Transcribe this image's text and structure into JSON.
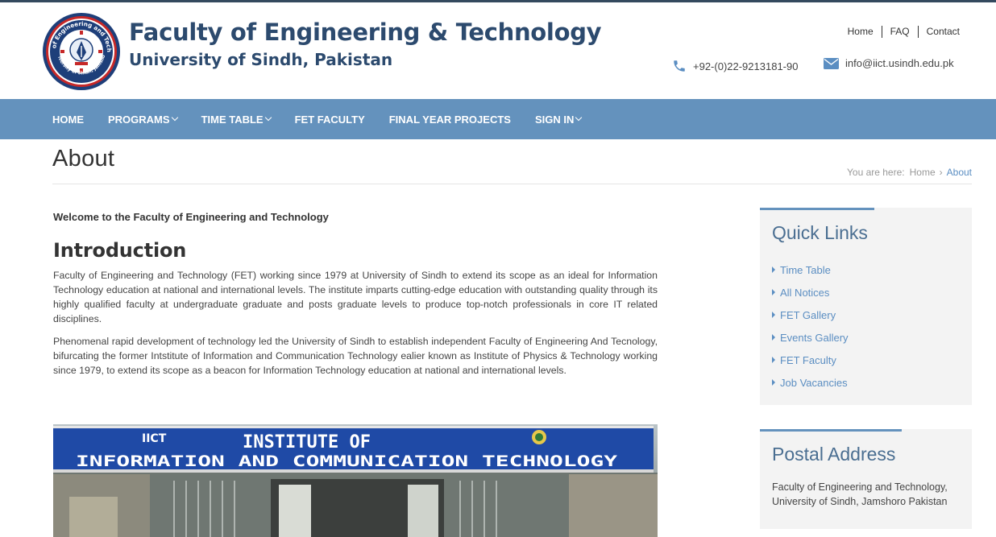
{
  "header": {
    "title": "Faculty of Engineering & Technology",
    "subtitle": "University of Sindh, Pakistan",
    "top_links": [
      "Home",
      "FAQ",
      "Contact"
    ],
    "phone": "+92-(0)22-9213181-90",
    "email": "info@iict.usindh.edu.pk",
    "logo_text_top": "Faculty of Engineering and Technology",
    "logo_text_bottom": "University of Sindh, Jamshoro",
    "colors": {
      "title": "#2c4a6e",
      "topline": "#34495e"
    }
  },
  "nav": {
    "items": [
      {
        "label": "HOME",
        "dropdown": false
      },
      {
        "label": "PROGRAMS",
        "dropdown": true
      },
      {
        "label": "TIME TABLE",
        "dropdown": true
      },
      {
        "label": "FET FACULTY",
        "dropdown": false
      },
      {
        "label": "FINAL YEAR PROJECTS",
        "dropdown": false
      },
      {
        "label": "SIGN IN",
        "dropdown": true
      }
    ],
    "background": "#6492bd"
  },
  "page": {
    "title": "About",
    "breadcrumb": {
      "prefix": "You are here:",
      "home": "Home",
      "current": "About"
    }
  },
  "main": {
    "welcome": "Welcome to the Faculty of Engineering and Technology",
    "intro_heading": "Introduction",
    "paragraphs": [
      "Faculty of Engineering and Technology (FET) working since 1979 at University of Sindh to extend its scope as an ideal for Information Technology education at national and international levels. The institute imparts cutting-edge education with outstanding quality through its highly qualified faculty at undergraduate graduate and posts graduate levels to produce top-notch professionals in core IT related disciplines.",
      "Phenomenal rapid development of technology led the University of Sindh to establish independent Faculty of Engineering And Tecnology, bifurcating the former Intstitute of Information and Communication Technology ealier known as Institute of Physics & Technology working since 1979, to extend its scope as a beacon for Information Technology education at national and international levels."
    ],
    "photo_sign": {
      "line1": "INSTITUTE OF",
      "line2": "INFORMATION AND COMMUNICATION TECHNOLOGY",
      "badge": "IICT"
    }
  },
  "sidebar": {
    "quick_links": {
      "title": "Quick Links",
      "items": [
        "Time Table",
        "All Notices",
        "FET Gallery",
        "Events Gallery",
        "FET Faculty",
        "Job Vacancies"
      ]
    },
    "postal": {
      "title": "Postal Address",
      "lines": [
        "Faculty of Engineering and Technology,",
        "University of Sindh, Jamshoro Pakistan"
      ]
    },
    "link_color": "#5b8ec2"
  }
}
